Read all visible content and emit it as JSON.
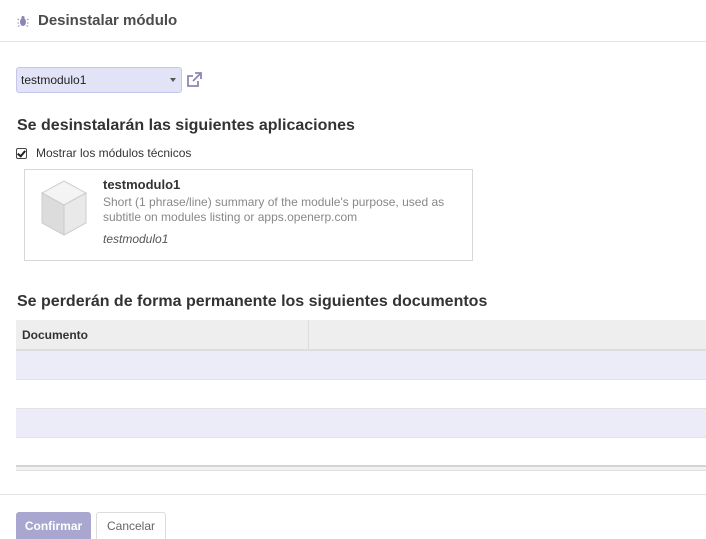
{
  "dialog": {
    "title": "Desinstalar módulo",
    "icon": "bug-icon"
  },
  "module_selector": {
    "selected_value": "testmodulo1",
    "link_icon": "external-link-icon"
  },
  "apps_section": {
    "title": "Se desinstalarán las siguientes aplicaciones",
    "show_technical_label": "Mostrar los módulos técnicos",
    "show_technical_checked": true
  },
  "module_card": {
    "icon": "module-cube-icon",
    "name": "testmodulo1",
    "summary": "Short (1 phrase/line) summary of the module's purpose, used as subtitle on modules listing or apps.openerp.com",
    "technical_name": "testmodulo1"
  },
  "documents_section": {
    "title": "Se perderán de forma permanente los siguientes documentos",
    "columns": [
      "Documento",
      ""
    ],
    "rows": [
      [
        "",
        ""
      ],
      [
        "",
        ""
      ],
      [
        "",
        ""
      ],
      [
        "",
        ""
      ]
    ]
  },
  "footer": {
    "confirm_label": "Confirmar",
    "cancel_label": "Cancelar"
  },
  "colors": {
    "accent": "#a9a7cf",
    "select_bg": "#e3e3f8",
    "row_stripe": "#ececf9"
  }
}
